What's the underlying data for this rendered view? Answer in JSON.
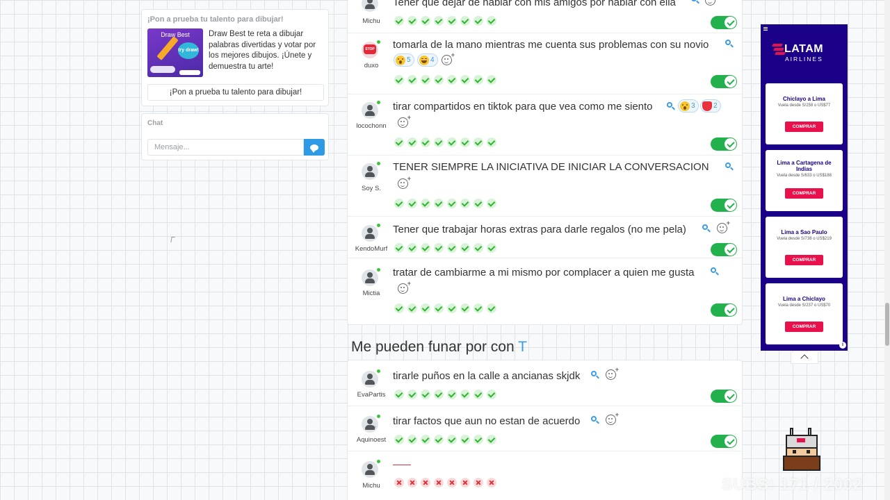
{
  "promo": {
    "title": "¡Pon a prueba tu talento para dibujar!",
    "thumb_title": "Draw Best",
    "thumb_bubble": "try draw!",
    "description": "Draw Best te reta a dibujar palabras divertidas y votar por los mejores dibujos. ¡Únete y demuestra tu arte!",
    "button_label": "¡Pon a prueba tu talento para dibujar!"
  },
  "chat": {
    "title": "Chat",
    "placeholder": "Mensaje..."
  },
  "feed": {
    "entries_top": [
      {
        "user": "Michu",
        "text": "Tener que dejar de hablar con mis amigos por hablar con ella",
        "votes": 8,
        "vote_type": "check",
        "approved": true
      },
      {
        "user": "duxo",
        "text": "tomarla de la mano mientras me cuenta sus problemas con su novio",
        "avatar": "stop-sign",
        "reactions": [
          {
            "emoji": "wow",
            "count": "5"
          },
          {
            "emoji": "laugh",
            "count": "4"
          }
        ],
        "votes": 8,
        "vote_type": "check",
        "approved": true
      },
      {
        "user": "locochonn",
        "text": "tirar compartidos en tiktok para que vea como me siento",
        "reactions": [
          {
            "emoji": "wow",
            "count": "3"
          },
          {
            "emoji": "heart",
            "count": "2"
          }
        ],
        "votes": 8,
        "vote_type": "check",
        "approved": true
      },
      {
        "user": "Soy S.",
        "text": "TENER SIEMPRE LA INICIATIVA DE INICIAR LA CONVERSACION",
        "votes": 8,
        "vote_type": "check",
        "approved": true
      },
      {
        "user": "KendoMurf",
        "text": "Tener que trabajar horas extras para darle regalos (no me pela)",
        "votes": 8,
        "vote_type": "check",
        "approved": true
      },
      {
        "user": "Mictia",
        "text": "tratar de cambiarme a mi mismo por complacer a quien me gusta",
        "votes": 8,
        "vote_type": "check",
        "approved": true
      }
    ],
    "section_heading": "Me pueden funar por con",
    "section_letter": "T",
    "entries_bottom": [
      {
        "user": "EvaPartis",
        "text": "tirarle puños en la calle a ancianas skjdk",
        "votes": 8,
        "vote_type": "check",
        "approved": true
      },
      {
        "user": "Aquinoest",
        "text": "tirar factos que aun no estan de acuerdo",
        "votes": 8,
        "vote_type": "check",
        "approved": true
      },
      {
        "user": "Michu",
        "text": "",
        "votes": 8,
        "vote_type": "cross",
        "approved": false
      }
    ]
  },
  "ad": {
    "brand": "LATAM",
    "brand_sub": "AIRLINES",
    "offers": [
      {
        "route": "Chiclayo a Lima",
        "price": "Vuela desde S/258 o US$77",
        "button": "COMPRAR"
      },
      {
        "route": "Lima a Cartagena de Indias",
        "price": "Vuela desde S/633 o US$188",
        "button": "COMPRAR"
      },
      {
        "route": "Lima a Sao Paulo",
        "price": "Vuela desde S/738 o US$219",
        "button": "COMPRAR"
      },
      {
        "route": "Lima a Chiclayo",
        "price": "Vuela desde S/237 o US$70",
        "button": "COMPRAR"
      }
    ],
    "info": "i"
  },
  "overlay": {
    "subs_text": "SUBS: 171 / 2002"
  },
  "colors": {
    "accent": "#3a9be6",
    "approved": "#22b14c",
    "rejected": "#e0303a",
    "ad_background": "#1b0088",
    "ad_button": "#e8114b"
  }
}
